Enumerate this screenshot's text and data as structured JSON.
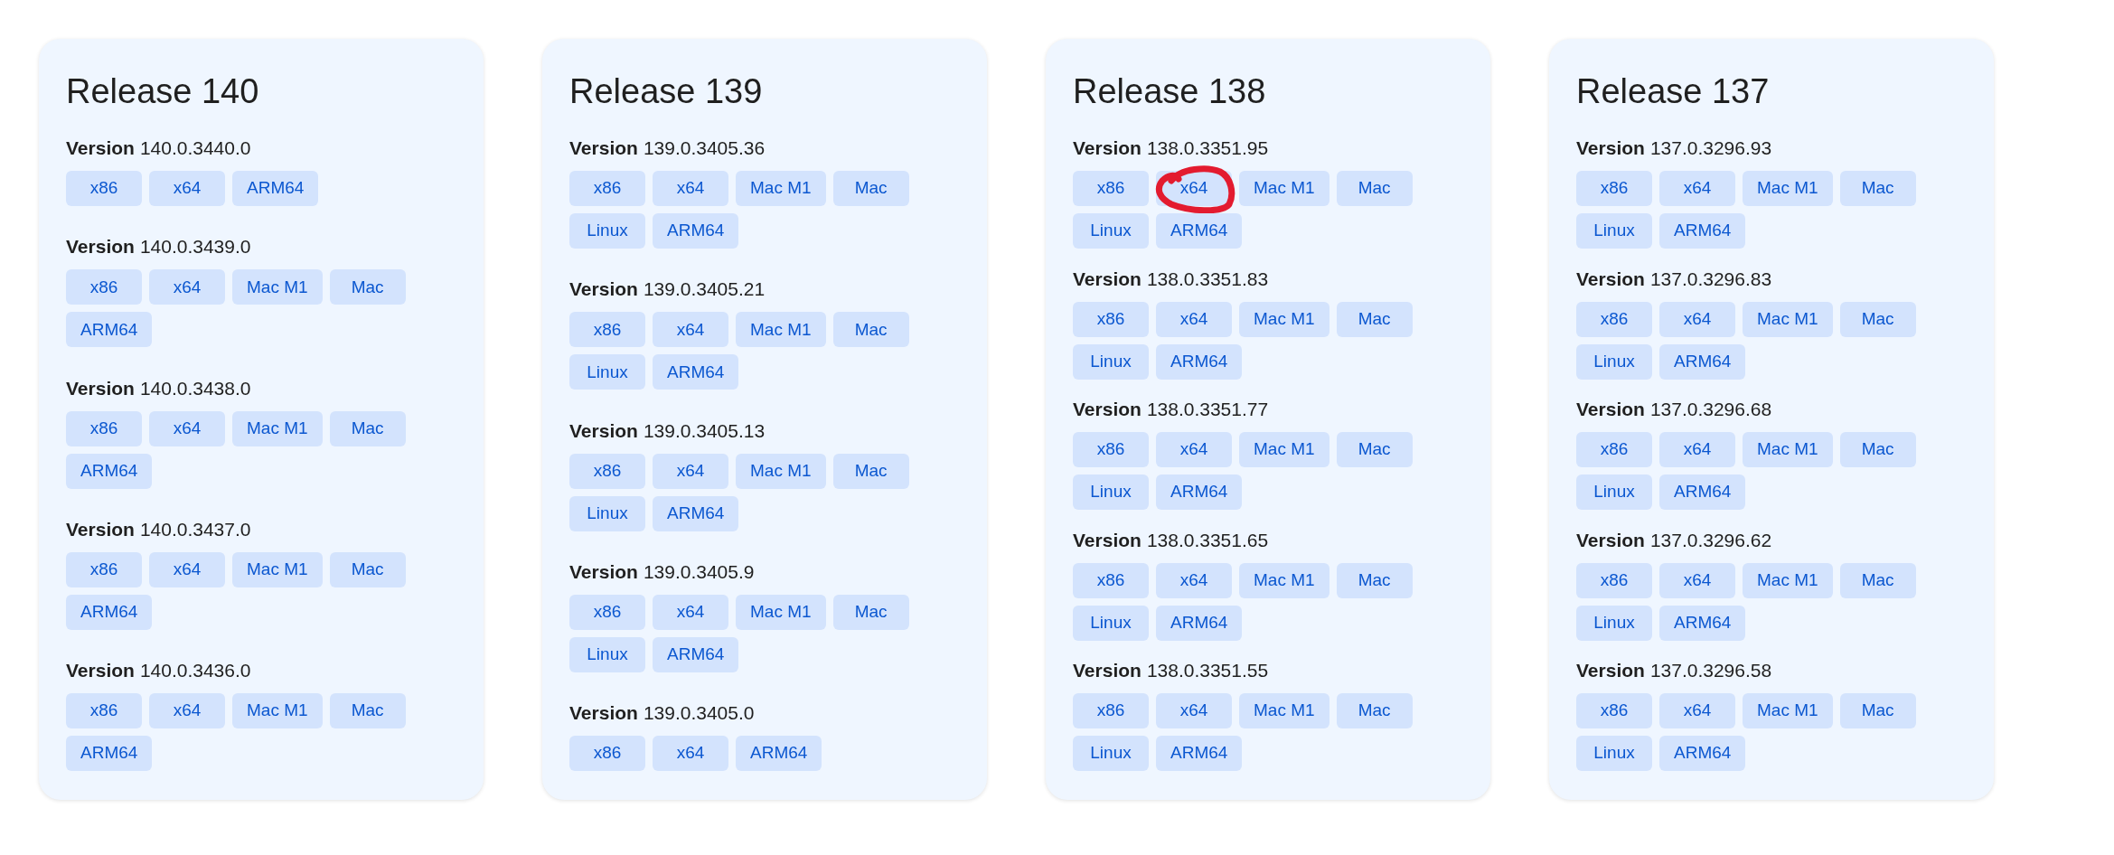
{
  "releases": [
    {
      "title": "Release 140",
      "versions": [
        {
          "label": "Version",
          "number": "140.0.3440.0",
          "buttons": [
            {
              "label": "x86",
              "circled": false
            },
            {
              "label": "x64",
              "circled": false
            },
            {
              "label": "ARM64",
              "circled": false
            }
          ]
        },
        {
          "label": "Version",
          "number": "140.0.3439.0",
          "buttons": [
            {
              "label": "x86",
              "circled": false
            },
            {
              "label": "x64",
              "circled": false
            },
            {
              "label": "Mac M1",
              "circled": false
            },
            {
              "label": "Mac",
              "circled": false
            },
            {
              "label": "ARM64",
              "circled": false
            }
          ]
        },
        {
          "label": "Version",
          "number": "140.0.3438.0",
          "buttons": [
            {
              "label": "x86",
              "circled": false
            },
            {
              "label": "x64",
              "circled": false
            },
            {
              "label": "Mac M1",
              "circled": false
            },
            {
              "label": "Mac",
              "circled": false
            },
            {
              "label": "ARM64",
              "circled": false
            }
          ]
        },
        {
          "label": "Version",
          "number": "140.0.3437.0",
          "buttons": [
            {
              "label": "x86",
              "circled": false
            },
            {
              "label": "x64",
              "circled": false
            },
            {
              "label": "Mac M1",
              "circled": false
            },
            {
              "label": "Mac",
              "circled": false
            },
            {
              "label": "ARM64",
              "circled": false
            }
          ]
        },
        {
          "label": "Version",
          "number": "140.0.3436.0",
          "buttons": [
            {
              "label": "x86",
              "circled": false
            },
            {
              "label": "x64",
              "circled": false
            },
            {
              "label": "Mac M1",
              "circled": false
            },
            {
              "label": "Mac",
              "circled": false
            },
            {
              "label": "ARM64",
              "circled": false
            }
          ]
        }
      ]
    },
    {
      "title": "Release 139",
      "versions": [
        {
          "label": "Version",
          "number": "139.0.3405.36",
          "buttons": [
            {
              "label": "x86",
              "circled": false
            },
            {
              "label": "x64",
              "circled": false
            },
            {
              "label": "Mac M1",
              "circled": false
            },
            {
              "label": "Mac",
              "circled": false
            },
            {
              "label": "Linux",
              "circled": false
            },
            {
              "label": "ARM64",
              "circled": false
            }
          ]
        },
        {
          "label": "Version",
          "number": "139.0.3405.21",
          "buttons": [
            {
              "label": "x86",
              "circled": false
            },
            {
              "label": "x64",
              "circled": false
            },
            {
              "label": "Mac M1",
              "circled": false
            },
            {
              "label": "Mac",
              "circled": false
            },
            {
              "label": "Linux",
              "circled": false
            },
            {
              "label": "ARM64",
              "circled": false
            }
          ]
        },
        {
          "label": "Version",
          "number": "139.0.3405.13",
          "buttons": [
            {
              "label": "x86",
              "circled": false
            },
            {
              "label": "x64",
              "circled": false
            },
            {
              "label": "Mac M1",
              "circled": false
            },
            {
              "label": "Mac",
              "circled": false
            },
            {
              "label": "Linux",
              "circled": false
            },
            {
              "label": "ARM64",
              "circled": false
            }
          ]
        },
        {
          "label": "Version",
          "number": "139.0.3405.9",
          "buttons": [
            {
              "label": "x86",
              "circled": false
            },
            {
              "label": "x64",
              "circled": false
            },
            {
              "label": "Mac M1",
              "circled": false
            },
            {
              "label": "Mac",
              "circled": false
            },
            {
              "label": "Linux",
              "circled": false
            },
            {
              "label": "ARM64",
              "circled": false
            }
          ]
        },
        {
          "label": "Version",
          "number": "139.0.3405.0",
          "buttons": [
            {
              "label": "x86",
              "circled": false
            },
            {
              "label": "x64",
              "circled": false
            },
            {
              "label": "ARM64",
              "circled": false
            }
          ]
        }
      ]
    },
    {
      "title": "Release 138",
      "versions": [
        {
          "label": "Version",
          "number": "138.0.3351.95",
          "buttons": [
            {
              "label": "x86",
              "circled": false
            },
            {
              "label": "x64",
              "circled": true
            },
            {
              "label": "Mac M1",
              "circled": false
            },
            {
              "label": "Mac",
              "circled": false
            },
            {
              "label": "Linux",
              "circled": false
            },
            {
              "label": "ARM64",
              "circled": false
            }
          ]
        },
        {
          "label": "Version",
          "number": "138.0.3351.83",
          "buttons": [
            {
              "label": "x86",
              "circled": false
            },
            {
              "label": "x64",
              "circled": false
            },
            {
              "label": "Mac M1",
              "circled": false
            },
            {
              "label": "Mac",
              "circled": false
            },
            {
              "label": "Linux",
              "circled": false
            },
            {
              "label": "ARM64",
              "circled": false
            }
          ]
        },
        {
          "label": "Version",
          "number": "138.0.3351.77",
          "buttons": [
            {
              "label": "x86",
              "circled": false
            },
            {
              "label": "x64",
              "circled": false
            },
            {
              "label": "Mac M1",
              "circled": false
            },
            {
              "label": "Mac",
              "circled": false
            },
            {
              "label": "Linux",
              "circled": false
            },
            {
              "label": "ARM64",
              "circled": false
            }
          ]
        },
        {
          "label": "Version",
          "number": "138.0.3351.65",
          "buttons": [
            {
              "label": "x86",
              "circled": false
            },
            {
              "label": "x64",
              "circled": false
            },
            {
              "label": "Mac M1",
              "circled": false
            },
            {
              "label": "Mac",
              "circled": false
            },
            {
              "label": "Linux",
              "circled": false
            },
            {
              "label": "ARM64",
              "circled": false
            }
          ]
        },
        {
          "label": "Version",
          "number": "138.0.3351.55",
          "buttons": [
            {
              "label": "x86",
              "circled": false
            },
            {
              "label": "x64",
              "circled": false
            },
            {
              "label": "Mac M1",
              "circled": false
            },
            {
              "label": "Mac",
              "circled": false
            },
            {
              "label": "Linux",
              "circled": false
            },
            {
              "label": "ARM64",
              "circled": false
            }
          ]
        }
      ]
    },
    {
      "title": "Release 137",
      "versions": [
        {
          "label": "Version",
          "number": "137.0.3296.93",
          "buttons": [
            {
              "label": "x86",
              "circled": false
            },
            {
              "label": "x64",
              "circled": false
            },
            {
              "label": "Mac M1",
              "circled": false
            },
            {
              "label": "Mac",
              "circled": false
            },
            {
              "label": "Linux",
              "circled": false
            },
            {
              "label": "ARM64",
              "circled": false
            }
          ]
        },
        {
          "label": "Version",
          "number": "137.0.3296.83",
          "buttons": [
            {
              "label": "x86",
              "circled": false
            },
            {
              "label": "x64",
              "circled": false
            },
            {
              "label": "Mac M1",
              "circled": false
            },
            {
              "label": "Mac",
              "circled": false
            },
            {
              "label": "Linux",
              "circled": false
            },
            {
              "label": "ARM64",
              "circled": false
            }
          ]
        },
        {
          "label": "Version",
          "number": "137.0.3296.68",
          "buttons": [
            {
              "label": "x86",
              "circled": false
            },
            {
              "label": "x64",
              "circled": false
            },
            {
              "label": "Mac M1",
              "circled": false
            },
            {
              "label": "Mac",
              "circled": false
            },
            {
              "label": "Linux",
              "circled": false
            },
            {
              "label": "ARM64",
              "circled": false
            }
          ]
        },
        {
          "label": "Version",
          "number": "137.0.3296.62",
          "buttons": [
            {
              "label": "x86",
              "circled": false
            },
            {
              "label": "x64",
              "circled": false
            },
            {
              "label": "Mac M1",
              "circled": false
            },
            {
              "label": "Mac",
              "circled": false
            },
            {
              "label": "Linux",
              "circled": false
            },
            {
              "label": "ARM64",
              "circled": false
            }
          ]
        },
        {
          "label": "Version",
          "number": "137.0.3296.58",
          "buttons": [
            {
              "label": "x86",
              "circled": false
            },
            {
              "label": "x64",
              "circled": false
            },
            {
              "label": "Mac M1",
              "circled": false
            },
            {
              "label": "Mac",
              "circled": false
            },
            {
              "label": "Linux",
              "circled": false
            },
            {
              "label": "ARM64",
              "circled": false
            }
          ]
        }
      ]
    }
  ]
}
